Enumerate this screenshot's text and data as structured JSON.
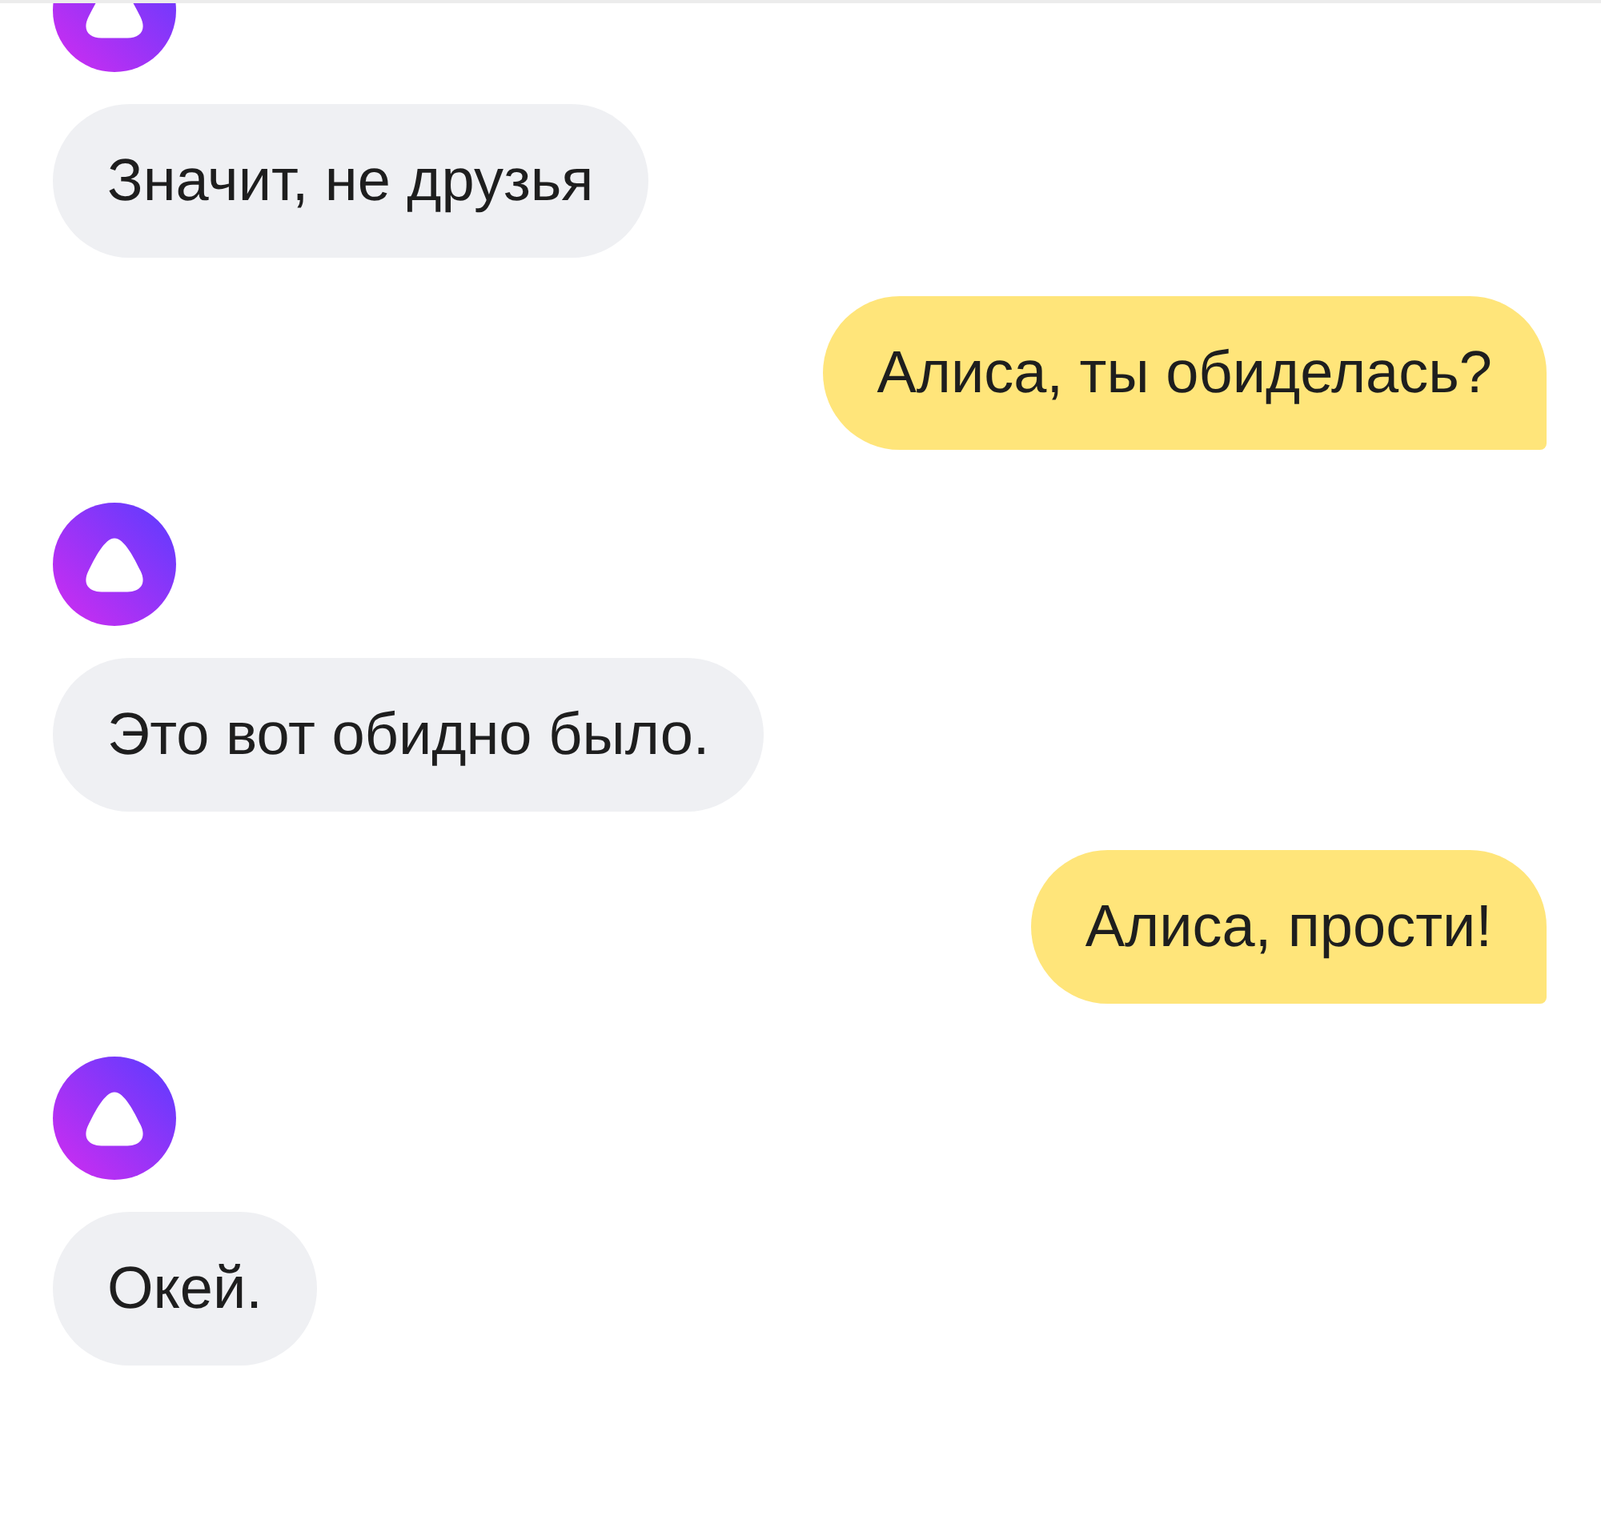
{
  "messages": [
    {
      "kind": "assistant",
      "avatar": true,
      "text": "Значит, не друзья"
    },
    {
      "kind": "user",
      "text": "Алиса, ты обиделась?"
    },
    {
      "kind": "assistant",
      "avatar": true,
      "text": "Это вот обидно было."
    },
    {
      "kind": "user",
      "text": "Алиса, прости!"
    },
    {
      "kind": "assistant",
      "avatar": true,
      "text": "Окей."
    }
  ]
}
